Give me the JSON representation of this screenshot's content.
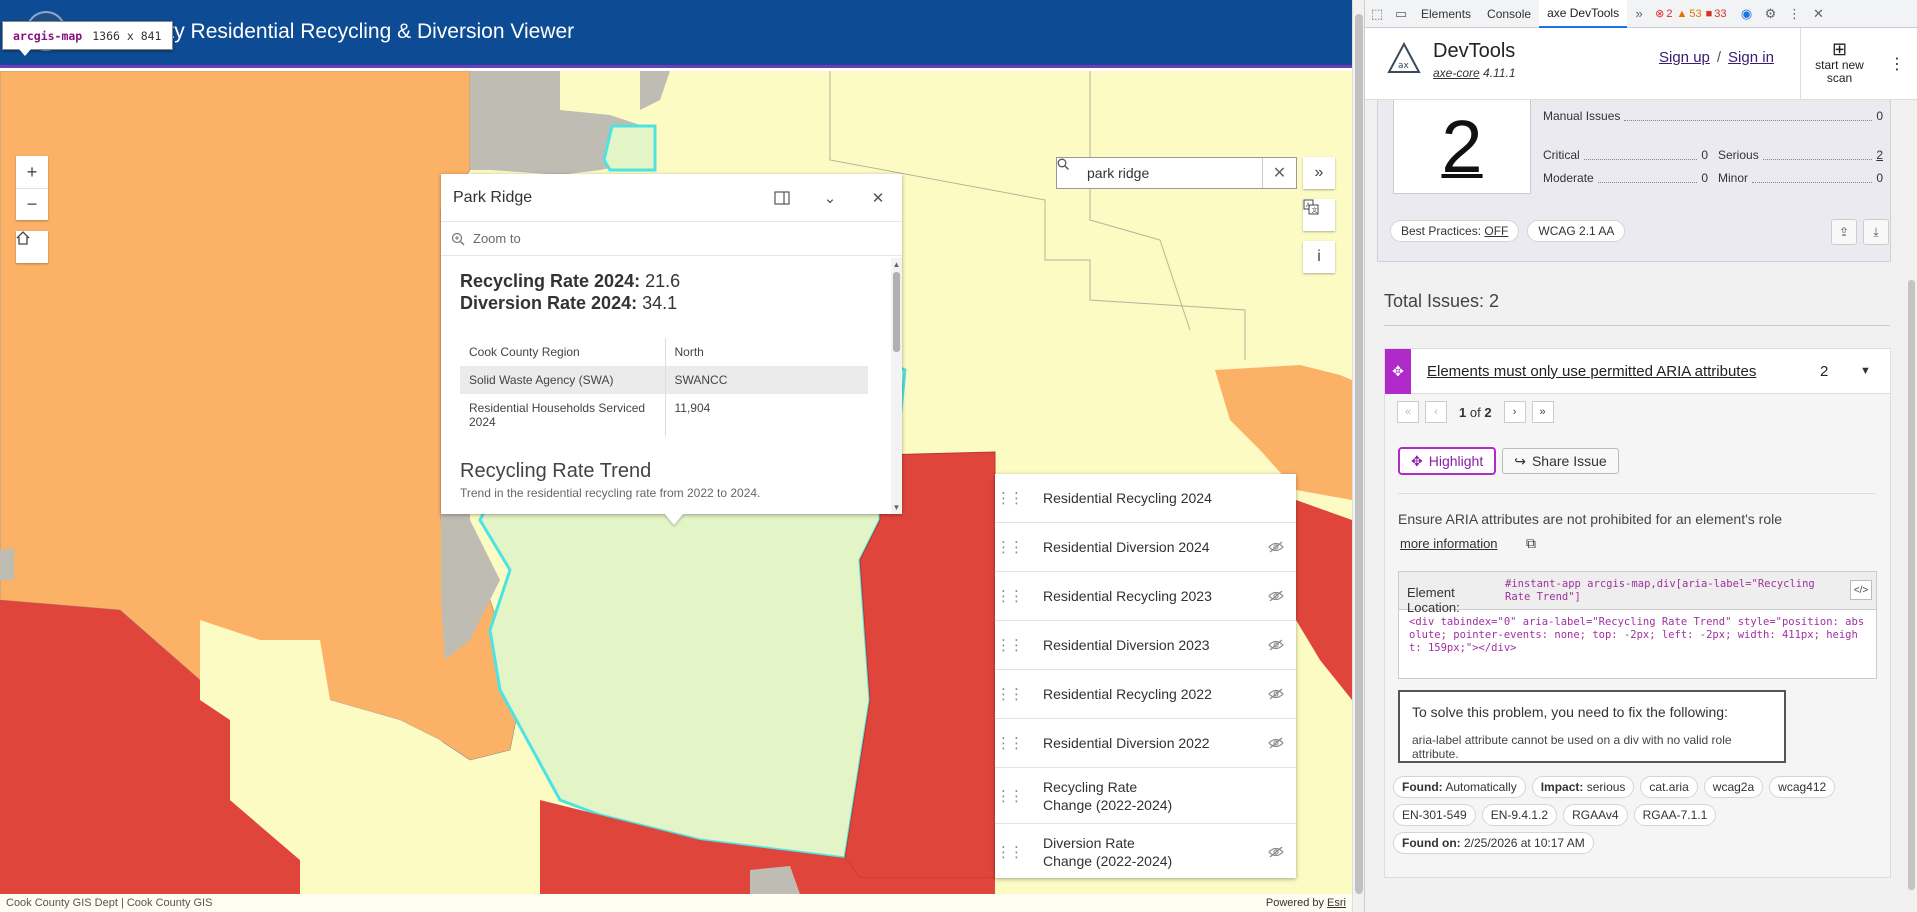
{
  "header": {
    "title": "unty Residential Recycling & Diversion Viewer"
  },
  "inspector": {
    "tag": "arcgis-map",
    "dims": "1366 x 841"
  },
  "search": {
    "value": "park ridge"
  },
  "popup": {
    "title": "Park Ridge",
    "zoom_to": "Zoom to",
    "recycling_label": "Recycling Rate 2024:",
    "recycling_value": "21.6",
    "diversion_label": "Diversion Rate 2024:",
    "diversion_value": "34.1",
    "rows": [
      {
        "label": "Cook County Region",
        "value": "North"
      },
      {
        "label": "Solid Waste Agency (SWA)",
        "value": "SWANCC"
      },
      {
        "label": "Residential Households Serviced 2024",
        "value": "11,904"
      }
    ],
    "trend_title": "Recycling Rate Trend",
    "trend_desc": "Trend in the residential recycling rate from 2022 to 2024."
  },
  "layers": {
    "items": [
      {
        "label": "Residential Recycling 2024",
        "visible": true
      },
      {
        "label": "Residential Diversion 2024",
        "visible": false
      },
      {
        "label": "Residential Recycling 2023",
        "visible": false
      },
      {
        "label": "Residential Diversion 2023",
        "visible": false
      },
      {
        "label": "Residential Recycling 2022",
        "visible": false
      },
      {
        "label": "Residential Diversion 2022",
        "visible": false
      },
      {
        "label": "Recycling Rate Change (2022-2024)",
        "visible": true
      },
      {
        "label": "Diversion Rate Change (2022-2024)",
        "visible": false
      }
    ]
  },
  "attribution": {
    "left": "Cook County GIS Dept | Cook County GIS",
    "right_prefix": "Powered by ",
    "right_link": "Esri"
  },
  "map_colors": {
    "orange": "#fbb267",
    "light_yellow": "#fdfbc4",
    "red": "#e0453c",
    "gray": "#bfbdb3",
    "green": "#e3f4c6",
    "cyan": "#4ee3e3",
    "header": "#0d4c94"
  },
  "devtools": {
    "tabs": [
      "Elements",
      "Console",
      "axe DevTools"
    ],
    "active_tab": "axe DevTools",
    "errors": "2",
    "warnings": "53",
    "issues": "33"
  },
  "axe": {
    "name": "DevTools",
    "version_link": "axe-core",
    "version_num": "4.11.1",
    "sign_up": "Sign up",
    "separator": "/",
    "sign_in": "Sign in",
    "new_scan_1": "start new",
    "new_scan_2": "scan",
    "score": "2",
    "manual_label": "Manual Issues",
    "manual_value": "0",
    "critical_label": "Critical",
    "critical_value": "0",
    "serious_label": "Serious",
    "serious_value": "2",
    "moderate_label": "Moderate",
    "moderate_value": "0",
    "minor_label": "Minor",
    "minor_value": "0",
    "best_practices_label": "Best Practices:",
    "best_practices_value": "OFF",
    "wcag": "WCAG 2.1 AA",
    "total_issues": "Total Issues: 2",
    "issue": {
      "title": "Elements must only use permitted ARIA attributes",
      "count": "2",
      "pager_current": "1",
      "pager_of": "of",
      "pager_total": "2",
      "highlight": "Highlight",
      "share": "Share Issue",
      "description": "Ensure ARIA attributes are not prohibited for an element's role",
      "more_info": "more information",
      "location_label": "Element Location:",
      "location_selector": "#instant-app arcgis-map,div[aria-label=\"Recycling Rate Trend\"]",
      "code": "<div tabindex=\"0\" aria-label=\"Recycling Rate Trend\" style=\"position: absolute; pointer-events: none; top: -2px; left: -2px; width: 411px; height: 159px;\"></div>",
      "solve_title": "To solve this problem, you need to fix the following:",
      "solve_msg": "aria-label attribute cannot be used on a div with no valid role attribute.",
      "found_label": "Found:",
      "found_value": "Automatically",
      "impact_label": "Impact:",
      "impact_value": "serious",
      "tags": [
        "cat.aria",
        "wcag2a",
        "wcag412",
        "EN-301-549",
        "EN-9.4.1.2",
        "RGAAv4",
        "RGAA-7.1.1"
      ],
      "found_on_label": "Found on:",
      "found_on_value": "2/25/2026 at 10:17 AM"
    }
  }
}
